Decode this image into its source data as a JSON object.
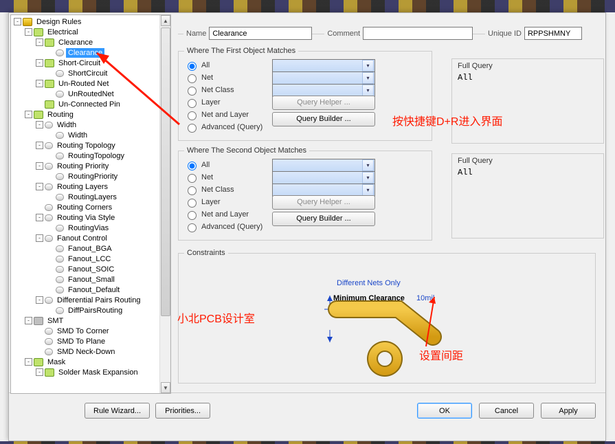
{
  "header": {
    "name_label": "Name",
    "name_value": "Clearance",
    "comment_label": "Comment",
    "comment_value": "",
    "uniqueid_label": "Unique ID",
    "uniqueid_value": "RPPSHMNY"
  },
  "match1": {
    "legend": "Where The First Object Matches",
    "opts": {
      "all": "All",
      "net": "Net",
      "netclass": "Net Class",
      "layer": "Layer",
      "netlayer": "Net and Layer",
      "adv": "Advanced (Query)"
    },
    "selected": "all",
    "btn_helper": "Query Helper ...",
    "btn_builder": "Query Builder ..."
  },
  "match2": {
    "legend": "Where The Second Object Matches",
    "opts": {
      "all": "All",
      "net": "Net",
      "netclass": "Net Class",
      "layer": "Layer",
      "netlayer": "Net and Layer",
      "adv": "Advanced (Query)"
    },
    "selected": "all",
    "btn_helper": "Query Helper ...",
    "btn_builder": "Query Builder ..."
  },
  "query1": {
    "title": "Full Query",
    "value": "All"
  },
  "query2": {
    "title": "Full Query",
    "value": "All"
  },
  "constraints": {
    "legend": "Constraints",
    "diff_nets": "Different Nets Only",
    "min_clear": "Minimum Clearance",
    "value": "10mil"
  },
  "annot": {
    "shortcut": "按快捷键D+R进入界面",
    "studio": "小北PCB设计室",
    "gap": "设置间距"
  },
  "footer": {
    "rule_wizard": "Rule Wizard...",
    "priorities": "Priorities...",
    "ok": "OK",
    "cancel": "Cancel",
    "apply": "Apply"
  },
  "tree": [
    {
      "d": 0,
      "exp": "-",
      "ic": "root",
      "t": "Design Rules"
    },
    {
      "d": 1,
      "exp": "-",
      "ic": "cat",
      "t": "Electrical"
    },
    {
      "d": 2,
      "exp": "-",
      "ic": "cat",
      "t": "Clearance"
    },
    {
      "d": 3,
      "exp": "",
      "ic": "rule",
      "t": "Clearance",
      "sel": true
    },
    {
      "d": 2,
      "exp": "-",
      "ic": "cat",
      "t": "Short-Circuit"
    },
    {
      "d": 3,
      "exp": "",
      "ic": "rule",
      "t": "ShortCircuit"
    },
    {
      "d": 2,
      "exp": "-",
      "ic": "cat",
      "t": "Un-Routed Net"
    },
    {
      "d": 3,
      "exp": "",
      "ic": "rule",
      "t": "UnRoutedNet"
    },
    {
      "d": 2,
      "exp": "",
      "ic": "cat",
      "t": "Un-Connected Pin"
    },
    {
      "d": 1,
      "exp": "-",
      "ic": "cat",
      "t": "Routing"
    },
    {
      "d": 2,
      "exp": "-",
      "ic": "rule",
      "t": "Width"
    },
    {
      "d": 3,
      "exp": "",
      "ic": "rule",
      "t": "Width"
    },
    {
      "d": 2,
      "exp": "-",
      "ic": "rule",
      "t": "Routing Topology"
    },
    {
      "d": 3,
      "exp": "",
      "ic": "rule",
      "t": "RoutingTopology"
    },
    {
      "d": 2,
      "exp": "-",
      "ic": "rule",
      "t": "Routing Priority"
    },
    {
      "d": 3,
      "exp": "",
      "ic": "rule",
      "t": "RoutingPriority"
    },
    {
      "d": 2,
      "exp": "-",
      "ic": "rule",
      "t": "Routing Layers"
    },
    {
      "d": 3,
      "exp": "",
      "ic": "rule",
      "t": "RoutingLayers"
    },
    {
      "d": 2,
      "exp": "",
      "ic": "rule",
      "t": "Routing Corners"
    },
    {
      "d": 2,
      "exp": "-",
      "ic": "rule",
      "t": "Routing Via Style"
    },
    {
      "d": 3,
      "exp": "",
      "ic": "rule",
      "t": "RoutingVias"
    },
    {
      "d": 2,
      "exp": "-",
      "ic": "rule",
      "t": "Fanout Control"
    },
    {
      "d": 3,
      "exp": "",
      "ic": "rule",
      "t": "Fanout_BGA"
    },
    {
      "d": 3,
      "exp": "",
      "ic": "rule",
      "t": "Fanout_LCC"
    },
    {
      "d": 3,
      "exp": "",
      "ic": "rule",
      "t": "Fanout_SOIC"
    },
    {
      "d": 3,
      "exp": "",
      "ic": "rule",
      "t": "Fanout_Small"
    },
    {
      "d": 3,
      "exp": "",
      "ic": "rule",
      "t": "Fanout_Default"
    },
    {
      "d": 2,
      "exp": "-",
      "ic": "rule",
      "t": "Differential Pairs Routing"
    },
    {
      "d": 3,
      "exp": "",
      "ic": "rule",
      "t": "DiffPairsRouting"
    },
    {
      "d": 1,
      "exp": "-",
      "ic": "smt",
      "t": "SMT"
    },
    {
      "d": 2,
      "exp": "",
      "ic": "rule",
      "t": "SMD To Corner"
    },
    {
      "d": 2,
      "exp": "",
      "ic": "rule",
      "t": "SMD To Plane"
    },
    {
      "d": 2,
      "exp": "",
      "ic": "rule",
      "t": "SMD Neck-Down"
    },
    {
      "d": 1,
      "exp": "-",
      "ic": "cat",
      "t": "Mask"
    },
    {
      "d": 2,
      "exp": "-",
      "ic": "cat",
      "t": "Solder Mask Expansion"
    }
  ]
}
